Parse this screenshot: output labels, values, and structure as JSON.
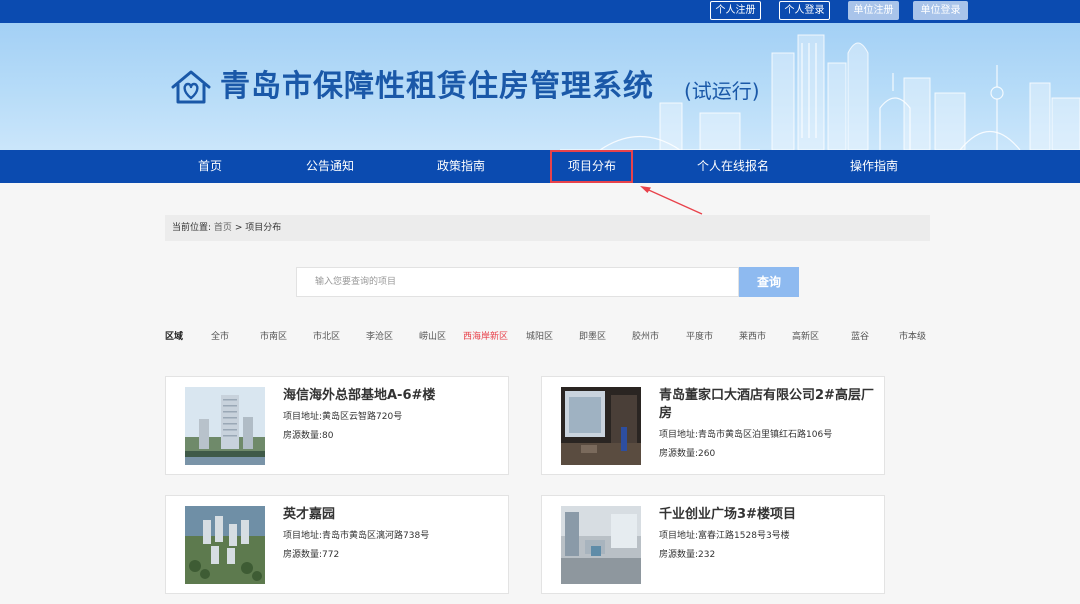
{
  "top_links": {
    "personal_register": "个人注册",
    "personal_login": "个人登录",
    "unit_register": "单位注册",
    "unit_login": "单位登录"
  },
  "site": {
    "title": "青岛市保障性租赁住房管理系统",
    "suffix": "(试运行)"
  },
  "nav": {
    "items": [
      "首页",
      "公告通知",
      "政策指南",
      "项目分布",
      "个人在线报名",
      "操作指南"
    ],
    "active": "项目分布"
  },
  "breadcrumb": {
    "label": "当前位置:",
    "home": "首页",
    "separator": ">",
    "current": "项目分布"
  },
  "search": {
    "placeholder": "输入您要查询的项目",
    "value": "",
    "button": "查询"
  },
  "districts": {
    "label": "区域",
    "items": [
      "全市",
      "市南区",
      "市北区",
      "李沧区",
      "崂山区",
      "西海岸新区",
      "城阳区",
      "即墨区",
      "胶州市",
      "平度市",
      "莱西市",
      "高新区",
      "蓝谷",
      "市本级"
    ],
    "active": "西海岸新区"
  },
  "projects": [
    {
      "title": "海信海外总部基地A-6#楼",
      "address_label": "项目地址:",
      "address": "黄岛区云智路720号",
      "count_label": "房源数量:",
      "count": "80"
    },
    {
      "title": "青岛董家口大酒店有限公司2#高层厂房",
      "address_label": "项目地址:",
      "address": "青岛市黄岛区泊里镇红石路106号",
      "count_label": "房源数量:",
      "count": "260"
    },
    {
      "title": "英才嘉园",
      "address_label": "项目地址:",
      "address": "青岛市黄岛区漓河路738号",
      "count_label": "房源数量:",
      "count": "772"
    },
    {
      "title": "千业创业广场3#楼项目",
      "address_label": "项目地址:",
      "address": "富春江路1528号3号楼",
      "count_label": "房源数量:",
      "count": "232"
    }
  ],
  "colors": {
    "primary": "#0b4bb0",
    "highlight": "#e8424b",
    "search_button": "#8ebaf0",
    "title_text": "#1a58a8"
  }
}
